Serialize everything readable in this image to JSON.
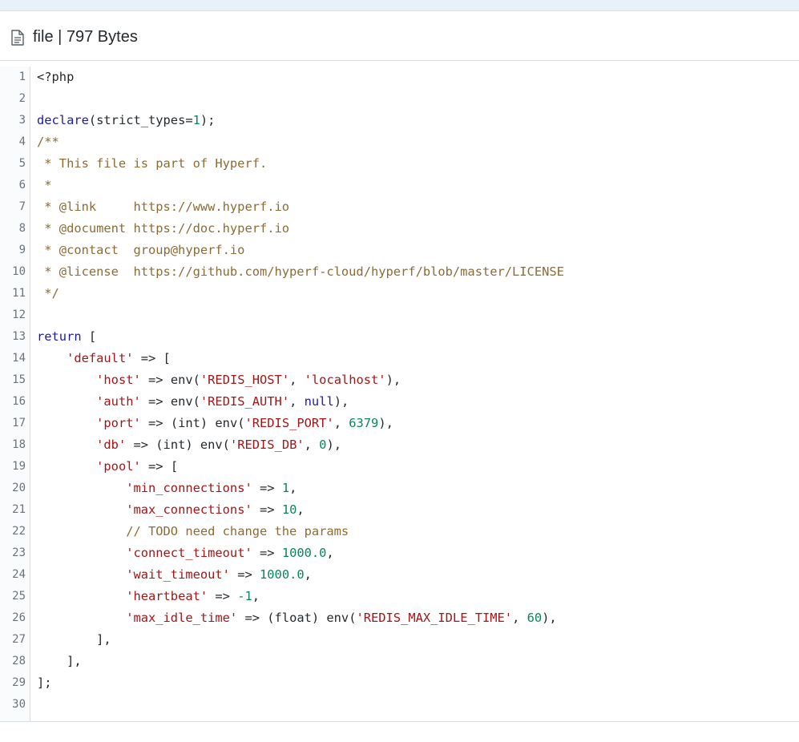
{
  "header": {
    "title": "file | 797 Bytes",
    "icon": "file-icon"
  },
  "colors": {
    "keyword": "#1a1aa6",
    "comment": "#8c6b34",
    "string": "#a31515",
    "number": "#098658",
    "plain": "#24292e",
    "gutter_text": "#6a737d"
  },
  "code": {
    "language": "php",
    "lines": [
      [
        {
          "t": "plain",
          "v": "<?php"
        }
      ],
      [],
      [
        {
          "t": "keyword",
          "v": "declare"
        },
        {
          "t": "plain",
          "v": "(strict_types="
        },
        {
          "t": "number",
          "v": "1"
        },
        {
          "t": "plain",
          "v": ");"
        }
      ],
      [
        {
          "t": "comment",
          "v": "/**"
        }
      ],
      [
        {
          "t": "comment",
          "v": " * This file is part of Hyperf."
        }
      ],
      [
        {
          "t": "comment",
          "v": " *"
        }
      ],
      [
        {
          "t": "comment",
          "v": " * @link     https://www.hyperf.io"
        }
      ],
      [
        {
          "t": "comment",
          "v": " * @document https://doc.hyperf.io"
        }
      ],
      [
        {
          "t": "comment",
          "v": " * @contact  group@hyperf.io"
        }
      ],
      [
        {
          "t": "comment",
          "v": " * @license  https://github.com/hyperf-cloud/hyperf/blob/master/LICENSE"
        }
      ],
      [
        {
          "t": "comment",
          "v": " */"
        }
      ],
      [],
      [
        {
          "t": "keyword",
          "v": "return"
        },
        {
          "t": "plain",
          "v": " ["
        }
      ],
      [
        {
          "t": "plain",
          "v": "    "
        },
        {
          "t": "string",
          "v": "'default'"
        },
        {
          "t": "plain",
          "v": " => ["
        }
      ],
      [
        {
          "t": "plain",
          "v": "        "
        },
        {
          "t": "string",
          "v": "'host'"
        },
        {
          "t": "plain",
          "v": " => env("
        },
        {
          "t": "string",
          "v": "'REDIS_HOST'"
        },
        {
          "t": "plain",
          "v": ", "
        },
        {
          "t": "string",
          "v": "'localhost'"
        },
        {
          "t": "plain",
          "v": "),"
        }
      ],
      [
        {
          "t": "plain",
          "v": "        "
        },
        {
          "t": "string",
          "v": "'auth'"
        },
        {
          "t": "plain",
          "v": " => env("
        },
        {
          "t": "string",
          "v": "'REDIS_AUTH'"
        },
        {
          "t": "plain",
          "v": ", "
        },
        {
          "t": "null",
          "v": "null"
        },
        {
          "t": "plain",
          "v": "),"
        }
      ],
      [
        {
          "t": "plain",
          "v": "        "
        },
        {
          "t": "string",
          "v": "'port'"
        },
        {
          "t": "plain",
          "v": " => (int) env("
        },
        {
          "t": "string",
          "v": "'REDIS_PORT'"
        },
        {
          "t": "plain",
          "v": ", "
        },
        {
          "t": "number",
          "v": "6379"
        },
        {
          "t": "plain",
          "v": "),"
        }
      ],
      [
        {
          "t": "plain",
          "v": "        "
        },
        {
          "t": "string",
          "v": "'db'"
        },
        {
          "t": "plain",
          "v": " => (int) env("
        },
        {
          "t": "string",
          "v": "'REDIS_DB'"
        },
        {
          "t": "plain",
          "v": ", "
        },
        {
          "t": "number",
          "v": "0"
        },
        {
          "t": "plain",
          "v": "),"
        }
      ],
      [
        {
          "t": "plain",
          "v": "        "
        },
        {
          "t": "string",
          "v": "'pool'"
        },
        {
          "t": "plain",
          "v": " => ["
        }
      ],
      [
        {
          "t": "plain",
          "v": "            "
        },
        {
          "t": "string",
          "v": "'min_connections'"
        },
        {
          "t": "plain",
          "v": " => "
        },
        {
          "t": "number",
          "v": "1"
        },
        {
          "t": "plain",
          "v": ","
        }
      ],
      [
        {
          "t": "plain",
          "v": "            "
        },
        {
          "t": "string",
          "v": "'max_connections'"
        },
        {
          "t": "plain",
          "v": " => "
        },
        {
          "t": "number",
          "v": "10"
        },
        {
          "t": "plain",
          "v": ","
        }
      ],
      [
        {
          "t": "plain",
          "v": "            "
        },
        {
          "t": "comment",
          "v": "// TODO need change the params"
        }
      ],
      [
        {
          "t": "plain",
          "v": "            "
        },
        {
          "t": "string",
          "v": "'connect_timeout'"
        },
        {
          "t": "plain",
          "v": " => "
        },
        {
          "t": "number",
          "v": "1000.0"
        },
        {
          "t": "plain",
          "v": ","
        }
      ],
      [
        {
          "t": "plain",
          "v": "            "
        },
        {
          "t": "string",
          "v": "'wait_timeout'"
        },
        {
          "t": "plain",
          "v": " => "
        },
        {
          "t": "number",
          "v": "1000.0"
        },
        {
          "t": "plain",
          "v": ","
        }
      ],
      [
        {
          "t": "plain",
          "v": "            "
        },
        {
          "t": "string",
          "v": "'heartbeat'"
        },
        {
          "t": "plain",
          "v": " => "
        },
        {
          "t": "number",
          "v": "-1"
        },
        {
          "t": "plain",
          "v": ","
        }
      ],
      [
        {
          "t": "plain",
          "v": "            "
        },
        {
          "t": "string",
          "v": "'max_idle_time'"
        },
        {
          "t": "plain",
          "v": " => (float) env("
        },
        {
          "t": "string",
          "v": "'REDIS_MAX_IDLE_TIME'"
        },
        {
          "t": "plain",
          "v": ", "
        },
        {
          "t": "number",
          "v": "60"
        },
        {
          "t": "plain",
          "v": "),"
        }
      ],
      [
        {
          "t": "plain",
          "v": "        ],"
        }
      ],
      [
        {
          "t": "plain",
          "v": "    ],"
        }
      ],
      [
        {
          "t": "plain",
          "v": "];"
        }
      ],
      []
    ]
  }
}
